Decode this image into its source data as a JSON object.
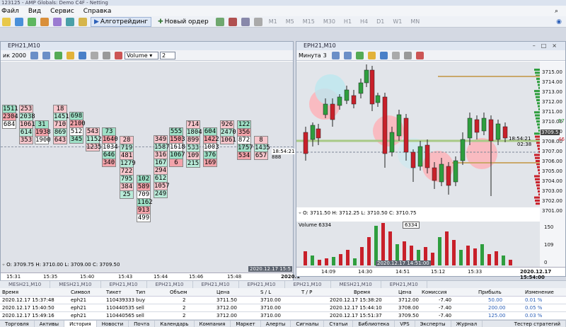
{
  "app": {
    "title_fragment": "123125 - AMP Globals: Demo C4F - Netting"
  },
  "menu": [
    "Файл",
    "Вид",
    "Сервис",
    "Справка"
  ],
  "toolbar": {
    "algo_label": "Алготрейдинг",
    "new_order_label": "Новый ордер",
    "timeframes": [
      "M1",
      "M5",
      "M15",
      "M30",
      "H1",
      "H4",
      "D1",
      "W1",
      "MN"
    ]
  },
  "left_window": {
    "title": "EPH21,M10",
    "mode_label": "Volume",
    "mode_value": "2",
    "partial_label": "ик 2000",
    "ohlc": "O: 3709.75  H: 3710.00  L: 3709.00  C: 3709.50",
    "time_badge": "18:54:21",
    "count_badge": "888",
    "date_badge": "2020.12.17 15:5",
    "xlabels": [
      "15:31",
      "15:35",
      "15:40",
      "15:43",
      "15:44",
      "15:46",
      "15:48",
      "2020.1"
    ],
    "clusters": [
      {
        "values": [
          "1511",
          "2304",
          "684"
        ]
      },
      {
        "values": [
          "253",
          "2038",
          "1061",
          "614",
          "353"
        ]
      },
      {
        "values": [
          "31",
          "1938",
          "1900"
        ]
      },
      {
        "values": [
          "18",
          "1451",
          "710",
          "869",
          "643"
        ]
      },
      {
        "values": [
          "698",
          "2100",
          "512",
          "345"
        ]
      },
      {
        "values": [
          "543",
          "1152",
          "1235"
        ]
      },
      {
        "values": [
          "73",
          "1640",
          "1034",
          "646",
          "340"
        ]
      },
      {
        "values": [
          "28",
          "719",
          "481",
          "1279",
          "722",
          "795",
          "384",
          "25"
        ]
      },
      {
        "values": [
          "102",
          "589",
          "709",
          "1162",
          "913",
          "499"
        ]
      },
      {
        "values": [
          "349",
          "1587",
          "316",
          "167",
          "294",
          "612",
          "1057",
          "249"
        ]
      },
      {
        "values": [
          "555",
          "1503",
          "1618",
          "1067",
          "6"
        ]
      },
      {
        "values": [
          "714",
          "1804",
          "899",
          "533",
          "109",
          "215"
        ]
      },
      {
        "values": [
          "604",
          "1422",
          "1003",
          "376",
          "169"
        ]
      },
      {
        "values": [
          "926",
          "2470",
          "1061"
        ]
      },
      {
        "values": [
          "122",
          "356",
          "872",
          "1757",
          "534"
        ]
      },
      {
        "values": [
          "8",
          "1435",
          "657"
        ]
      }
    ]
  },
  "right_window": {
    "title": "EPH21,M10",
    "mode_label": "Минута",
    "mode_value": "3",
    "ohlc": "O: 3711.50  H: 3712.25  L: 3710.50  C: 3710.75",
    "volume_label": "Volume 6334",
    "volume_badge": "6334",
    "price_badge": "3709.5",
    "time_badge": "18:54:21",
    "time_badge2": "02:38",
    "y_prices": [
      "3715.00",
      "3714.00",
      "3713.00",
      "3712.00",
      "3711.00",
      "3710.00",
      "3709.00",
      "3708.00",
      "3707.00",
      "3706.00",
      "3705.00",
      "3704.00",
      "3703.00",
      "3702.00",
      "3701.00"
    ],
    "vol_axis": [
      "150",
      "109",
      "0"
    ],
    "xlabels": [
      "14:09",
      "14:30",
      "14:51",
      "15:12",
      "15:33",
      "2020.12.17 15:54:00"
    ],
    "date_badge": "2020.12.17 14:51:00",
    "extra_price": "46",
    "extra_price2": "57"
  },
  "symbol_tabs": [
    "MESH21,M10",
    "MESH21,M10",
    "EPH21,M10",
    "EPH21,M10",
    "EPH21,M10",
    "EPH21,M10",
    "EPH21,M10",
    "MESH21,M10",
    "EPH21,M10"
  ],
  "trade_table": {
    "headers": [
      "Время",
      "Символ",
      "Тикет",
      "Тип",
      "Объем",
      "Цена",
      "S / L",
      "T / P",
      "Время",
      "Цена",
      "Комиссия",
      "Прибыль",
      "Изменение"
    ],
    "rows": [
      [
        "2020.12.17 15:37:48",
        "eph21",
        "110439333",
        "buy",
        "2",
        "3711.50",
        "3710.00",
        "",
        "2020.12.17 15:38:20",
        "3712.00",
        "-7.40",
        "50.00",
        "0.01 %"
      ],
      [
        "2020.12.17 15:40:50",
        "eph21",
        "110440535",
        "sell",
        "2",
        "3712.00",
        "3710.00",
        "",
        "2020.12.17 15:44:10",
        "3708.00",
        "-7.40",
        "200.00",
        "0.05 %"
      ],
      [
        "2020.12.17 15:49:16",
        "eph21",
        "110440565",
        "sell",
        "2",
        "3712.00",
        "3710.00",
        "",
        "2020.12.17 15:51:37",
        "3709.50",
        "-7.40",
        "125.00",
        "0.03 %"
      ]
    ]
  },
  "bottom_tabs": [
    "Торговля",
    "Активы",
    "История",
    "Новости",
    "Почта",
    "Календарь",
    "Компания",
    "Маркет",
    "Алерты",
    "Сигналы",
    "Статьи",
    "Библиотека",
    "VPS",
    "Эксперты",
    "Журнал",
    "Тестер стратегий"
  ],
  "colors": {
    "bull": "#2e9e3e",
    "bear": "#c8202a",
    "accent": "#2b5fb8",
    "cluster_red": "#f2a3aa",
    "cluster_green": "#9ee0c6"
  }
}
